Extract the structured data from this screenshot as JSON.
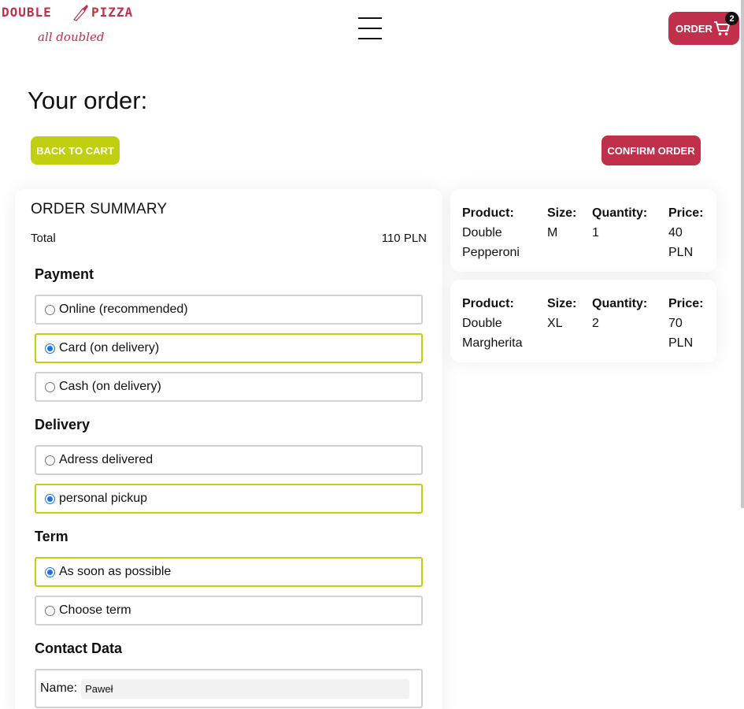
{
  "header": {
    "logo_left": "DOUBLE",
    "logo_right": "PIZZA",
    "tagline": "all doubled",
    "order_label": "ORDER",
    "cart_count": "2"
  },
  "page": {
    "title": "Your order:",
    "back_label": "BACK TO CART",
    "confirm_label": "CONFIRM ORDER"
  },
  "summary": {
    "title": "ORDER SUMMARY",
    "total_label": "Total",
    "total_value": "110 PLN",
    "payment": {
      "title": "Payment",
      "options": [
        {
          "label": "Online (recommended)",
          "selected": false
        },
        {
          "label": "Card (on delivery)",
          "selected": true
        },
        {
          "label": "Cash (on delivery)",
          "selected": false
        }
      ]
    },
    "delivery": {
      "title": "Delivery",
      "options": [
        {
          "label": "Adress delivered",
          "selected": false
        },
        {
          "label": "personal pickup",
          "selected": true
        }
      ]
    },
    "term": {
      "title": "Term",
      "options": [
        {
          "label": "As soon as possible",
          "selected": true
        },
        {
          "label": "Choose term",
          "selected": false
        }
      ]
    },
    "contact": {
      "title": "Contact Data",
      "name_label": "Name:",
      "name_value": "Paweł"
    }
  },
  "products": [
    {
      "product_header": "Product:",
      "product_line1": "Double",
      "product_line2": "Pepperoni",
      "size_header": "Size:",
      "size": "M",
      "quantity_header": "Quantity:",
      "quantity": "1",
      "price_header": "Price:",
      "price_line1": "40",
      "price_line2": "PLN"
    },
    {
      "product_header": "Product:",
      "product_line1": "Double",
      "product_line2": "Margherita",
      "size_header": "Size:",
      "size": "XL",
      "quantity_header": "Quantity:",
      "quantity": "2",
      "price_header": "Price:",
      "price_line1": "70",
      "price_line2": "PLN"
    }
  ],
  "colors": {
    "brand_red": "#c0304a",
    "accent_lime": "#c0cf10",
    "radio_blue": "#1a73e8"
  },
  "icons": [
    "pizza-knife-icon",
    "hamburger-menu-icon",
    "cart-icon"
  ]
}
